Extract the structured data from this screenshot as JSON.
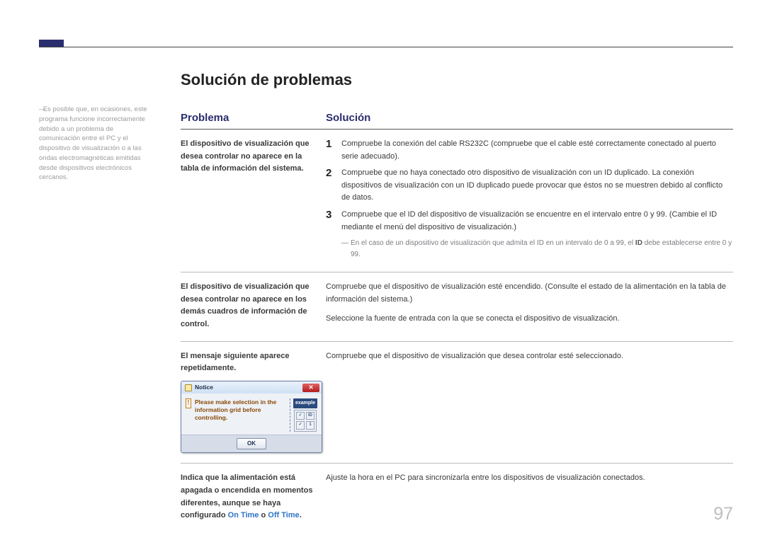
{
  "pageNumber": "97",
  "sideNote": "Es posible que, en ocasiones, este programa funcione incorrectamente debido a un problema de comunicación entre el PC y el dispositivo de visualización o a las ondas electromagnéticas emitidas desde dispositivos electrónicos cercanos.",
  "title": "Solución de problemas",
  "headers": {
    "problem": "Problema",
    "solution": "Solución"
  },
  "rows": {
    "r1": {
      "problem": "El dispositivo de visualización que desea controlar no aparece en la tabla de información del sistema.",
      "step1": "Compruebe la conexión del cable RS232C (compruebe que el cable esté correctamente conectado al puerto serie adecuado).",
      "step2": "Compruebe que no haya conectado otro dispositivo de visualización con un ID duplicado. La conexión dispositivos de visualización con un ID duplicado puede provocar que éstos no se muestren debido al conflicto de datos.",
      "step3": "Compruebe que el ID del dispositivo de visualización se encuentre en el intervalo entre 0 y 99. (Cambie el ID mediante el menú del dispositivo de visualización.)",
      "note_pre": "En el caso de un dispositivo de visualización que admita el ID en un intervalo de 0 a 99, el ",
      "note_bold": "ID",
      "note_post": " debe establecerse entre 0 y 99."
    },
    "r2": {
      "problem": "El dispositivo de visualización que desea controlar no aparece en los demás cuadros de información de control.",
      "sol_a": "Compruebe que el dispositivo de visualización esté encendido. (Consulte el estado de la alimentación en la tabla de información del sistema.)",
      "sol_b": "Seleccione la fuente de entrada con la que se conecta el dispositivo de visualización."
    },
    "r3": {
      "problem": "El mensaje siguiente aparece repetidamente.",
      "sol": "Compruebe que el dispositivo de visualización que desea controlar esté seleccionado.",
      "dialog": {
        "title": "Notice",
        "message": "Please make selection in the information grid before controlling.",
        "example": "example",
        "ok": "OK",
        "hId": "ID",
        "hChk": "✓",
        "c1": "1"
      }
    },
    "r4": {
      "problem_pre": "Indica que la alimentación está apagada o encendida en momentos diferentes, aunque se haya configurado ",
      "on": "On Time",
      "mid": " o ",
      "off": "Off Time",
      "end": ".",
      "sol": "Ajuste la hora en el PC para sincronizarla entre los dispositivos de visualización conectados."
    }
  }
}
